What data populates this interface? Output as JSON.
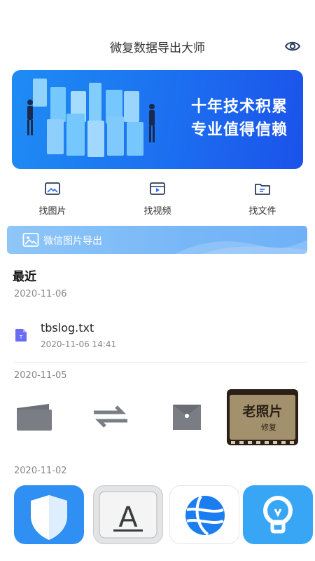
{
  "header": {
    "title": "微复数据导出大师"
  },
  "banner": {
    "line1": "十年技术积累",
    "line2": "专业值得信赖"
  },
  "quick_actions": [
    {
      "label": "找图片",
      "icon": "image-icon"
    },
    {
      "label": "找视频",
      "icon": "video-icon"
    },
    {
      "label": "找文件",
      "icon": "folder-icon"
    }
  ],
  "wechat_export": {
    "label": "微信图片导出"
  },
  "recent": {
    "heading": "最近",
    "groups": [
      {
        "date": "2020-11-06",
        "file": {
          "name": "tbslog.txt",
          "time": "2020-11-06 14:41",
          "badge": "T"
        }
      },
      {
        "date": "2020-11-05",
        "thumb_text_1": "老照片",
        "thumb_text_2": "修复"
      },
      {
        "date": "2020-11-02",
        "apps": [
          "shield-app-icon",
          "text-app-icon",
          "browser-app-icon",
          "lightbulb-app-icon"
        ],
        "app_letter": "A"
      }
    ]
  },
  "colors": {
    "accent": "#1c6ff0",
    "file_badge": "#6b6cf5",
    "gray_icon": "#7a7d84"
  }
}
